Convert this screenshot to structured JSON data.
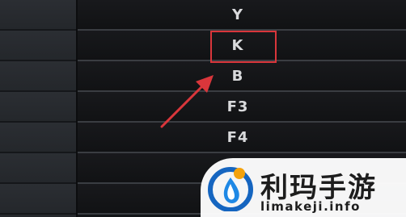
{
  "keybind_list": {
    "rows": [
      {
        "key": "Y"
      },
      {
        "key": "K"
      },
      {
        "key": "B"
      },
      {
        "key": "F3"
      },
      {
        "key": "F4"
      },
      {
        "key": ""
      },
      {
        "key": ""
      }
    ],
    "highlighted_key": "K"
  },
  "annotation": {
    "color": "#d9363b"
  },
  "watermark": {
    "title": "利玛手游",
    "domain": "limakeji.info",
    "logo_colors": [
      "#1565c0",
      "#f4a20c"
    ]
  }
}
